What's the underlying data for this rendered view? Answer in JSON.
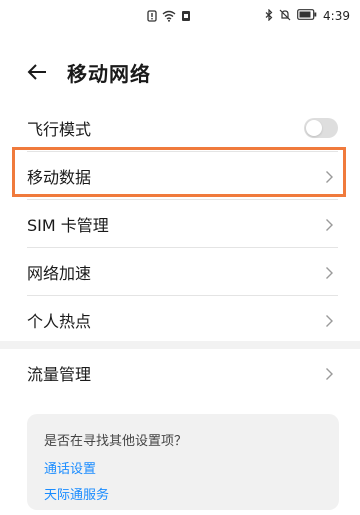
{
  "status_bar": {
    "time": "4:39",
    "left_icons": [
      "notification-icon",
      "wifi-icon",
      "sim-icon"
    ],
    "right_icons": [
      "bluetooth-icon",
      "mute-icon",
      "battery-icon"
    ]
  },
  "header": {
    "title": "移动网络",
    "back_icon": "back-arrow-icon"
  },
  "settings": {
    "items": [
      {
        "label": "飞行模式",
        "control": "toggle",
        "toggle_on": false
      },
      {
        "label": "移动数据",
        "control": "chevron",
        "highlighted": true
      },
      {
        "label": "SIM 卡管理",
        "control": "chevron"
      },
      {
        "label": "网络加速",
        "control": "chevron"
      },
      {
        "label": "个人热点",
        "control": "chevron"
      }
    ],
    "traffic": {
      "label": "流量管理",
      "control": "chevron"
    }
  },
  "suggestions": {
    "title": "是否在寻找其他设置项？",
    "links": [
      "通话设置",
      "天际通服务"
    ]
  },
  "colors": {
    "highlight_border": "#f07a3c",
    "link": "#1a8cff",
    "toggle_off": "#dedede"
  }
}
